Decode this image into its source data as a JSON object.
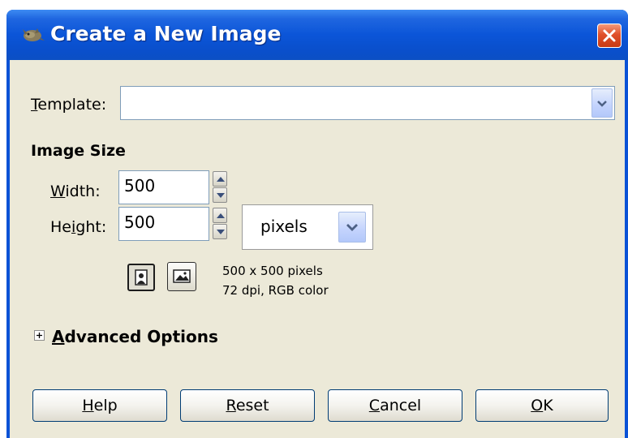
{
  "window": {
    "title": "Create a New Image",
    "app_icon": "gimp-wilber-icon",
    "close_icon": "close-icon"
  },
  "template": {
    "label_first": "T",
    "label_rest": "emplate:",
    "value": ""
  },
  "image_size": {
    "section_title": "Image Size",
    "width_label_first": "W",
    "width_label_rest": "idth:",
    "width_value": "500",
    "height_label_first": "He",
    "height_label_mid": "i",
    "height_label_rest": "ght:",
    "height_value": "500",
    "unit": "pixels",
    "orientation": {
      "portrait_icon": "portrait-icon",
      "landscape_icon": "landscape-icon",
      "selected": "portrait"
    },
    "info_line1": "500 x 500 pixels",
    "info_line2": "72 dpi, RGB color"
  },
  "advanced": {
    "expander_icon": "plus-icon",
    "label_first": "A",
    "label_rest": "dvanced Options"
  },
  "buttons": {
    "help_first": "H",
    "help_rest": "elp",
    "reset_first": "R",
    "reset_rest": "eset",
    "cancel_first": "C",
    "cancel_rest": "ancel",
    "ok_first": "O",
    "ok_rest": "K"
  },
  "colors": {
    "titlebar": "#0a52d6",
    "dialog_bg": "#ece9d8",
    "close_button": "#e0502a"
  }
}
